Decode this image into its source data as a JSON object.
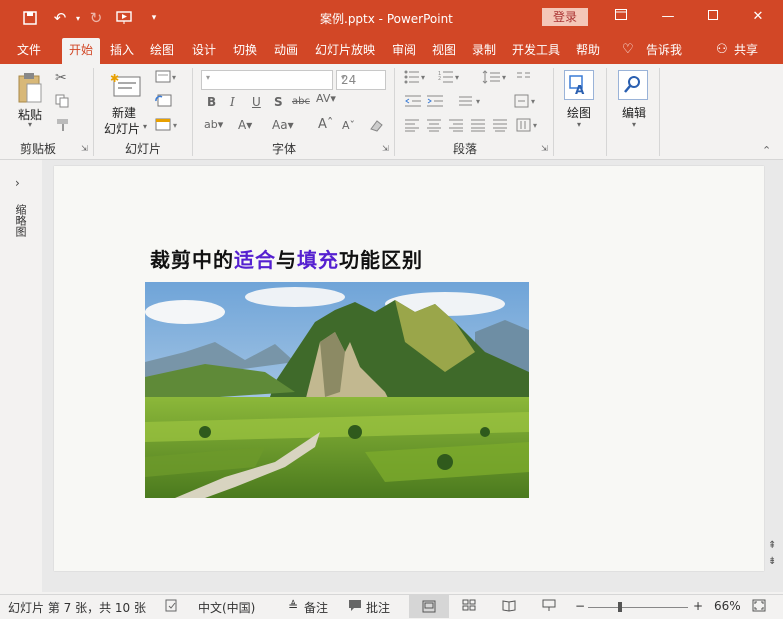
{
  "window": {
    "title": "案例.pptx  -  PowerPoint",
    "login_label": "登录",
    "accent": "#d24726"
  },
  "tabs": [
    "文件",
    "开始",
    "插入",
    "绘图",
    "设计",
    "切换",
    "动画",
    "幻灯片放映",
    "审阅",
    "视图",
    "录制",
    "开发工具",
    "帮助",
    "告诉我",
    "共享"
  ],
  "ribbon": {
    "clipboard": {
      "paste": "粘贴",
      "group": "剪贴板"
    },
    "slides": {
      "new_slide_1": "新建",
      "new_slide_2": "幻灯片",
      "group": "幻灯片"
    },
    "font": {
      "size": "24",
      "group": "字体"
    },
    "paragraph": {
      "group": "段落"
    },
    "drawing": {
      "label": "绘图"
    },
    "editing": {
      "label": "编辑"
    }
  },
  "left_pane": {
    "label": "缩略图"
  },
  "slide": {
    "title_parts": [
      "裁剪中的",
      "适合",
      "与",
      "填充",
      "功能区别"
    ]
  },
  "status": {
    "slide_info": "幻灯片 第 7 张，共 10 张",
    "language": "中文(中国)",
    "notes": "备注",
    "comments": "批注",
    "zoom": "66%"
  }
}
